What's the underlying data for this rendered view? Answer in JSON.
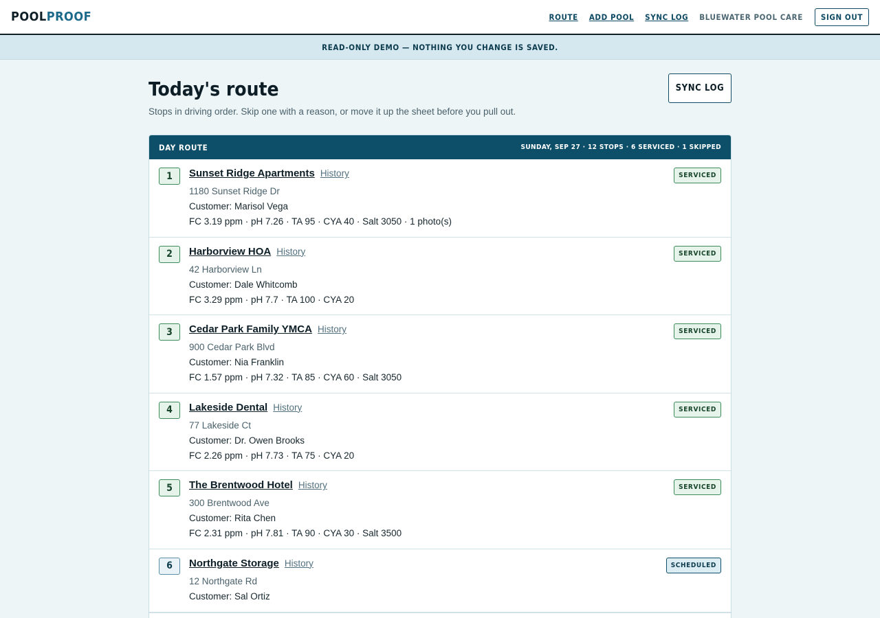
{
  "brand": {
    "part1": "POOL",
    "part2": "PROOF"
  },
  "nav": {
    "route": "ROUTE",
    "add_pool": "ADD POOL",
    "sync_log": "SYNC LOG",
    "org": "BLUEWATER POOL CARE",
    "sign_out": "SIGN OUT"
  },
  "banner": "READ-ONLY DEMO — NOTHING YOU CHANGE IS SAVED.",
  "page": {
    "title": "Today's route",
    "subtitle": "Stops in driving order. Skip one with a reason, or move it up the sheet before you pull out.",
    "sync_button": "SYNC LOG"
  },
  "card": {
    "label": "DAY ROUTE",
    "summary": "SUNDAY, SEP 27 · 12 STOPS · 6 SERVICED · 1 SKIPPED"
  },
  "stops": [
    {
      "num": "1",
      "name": "Sunset Ridge Apartments",
      "history": "History",
      "address": "1180 Sunset Ridge Dr",
      "customer": "Customer: Marisol Vega",
      "readings": "FC 3.19 ppm · pH 7.26 · TA 95 · CYA 40 · Salt 3050 · 1 photo(s)",
      "status": "SERVICED"
    },
    {
      "num": "2",
      "name": "Harborview HOA",
      "history": "History",
      "address": "42 Harborview Ln",
      "customer": "Customer: Dale Whitcomb",
      "readings": "FC 3.29 ppm · pH 7.7 · TA 100 · CYA 20",
      "status": "SERVICED"
    },
    {
      "num": "3",
      "name": "Cedar Park Family YMCA",
      "history": "History",
      "address": "900 Cedar Park Blvd",
      "customer": "Customer: Nia Franklin",
      "readings": "FC 1.57 ppm · pH 7.32 · TA 85 · CYA 60 · Salt 3050",
      "status": "SERVICED"
    },
    {
      "num": "4",
      "name": "Lakeside Dental",
      "history": "History",
      "address": "77 Lakeside Ct",
      "customer": "Customer: Dr. Owen Brooks",
      "readings": "FC 2.26 ppm · pH 7.73 · TA 75 · CYA 20",
      "status": "SERVICED"
    },
    {
      "num": "5",
      "name": "The Brentwood Hotel",
      "history": "History",
      "address": "300 Brentwood Ave",
      "customer": "Customer: Rita Chen",
      "readings": "FC 2.31 ppm · pH 7.81 · TA 90 · CYA 30 · Salt 3500",
      "status": "SERVICED"
    },
    {
      "num": "6",
      "name": "Northgate Storage",
      "history": "History",
      "address": "12 Northgate Rd",
      "customer": "Customer: Sal Ortiz",
      "readings": "",
      "status": "SCHEDULED"
    }
  ]
}
